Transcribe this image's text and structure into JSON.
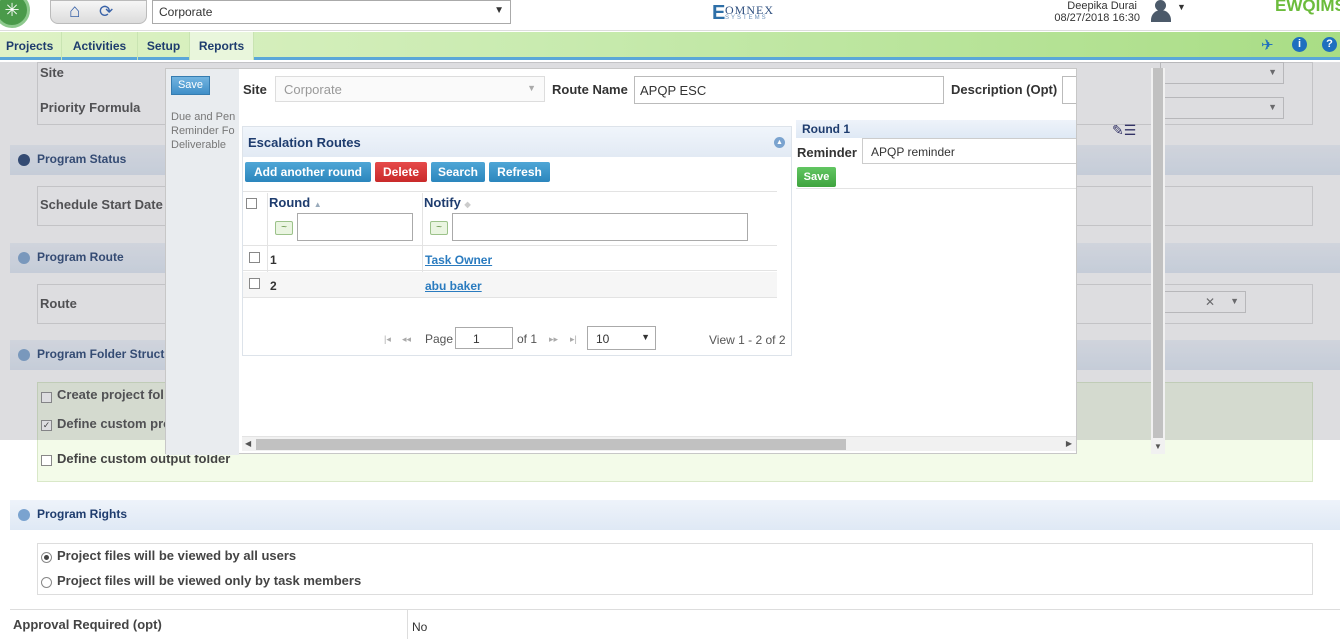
{
  "topbar": {
    "site_select": "Corporate",
    "brand": {
      "mark": "E",
      "name": "OMNEX",
      "tagline": "SYSTEMS"
    },
    "user_name": "Deepika Durai",
    "user_date": "08/27/2018 16:30",
    "app_logo": "EWQIMS"
  },
  "nav": {
    "items": [
      "Projects",
      "Activities",
      "Setup",
      "Reports"
    ]
  },
  "background": {
    "site_label": "Site",
    "priority_formula_label": "Priority Formula",
    "program_status": "Program Status",
    "schedule_start_date": "Schedule Start Date",
    "program_route": "Program Route",
    "route_label": "Route",
    "program_folder": "Program Folder Struct",
    "create_project_folder": "Create project fol",
    "define_custom_pro": "Define custom pro",
    "define_custom_output": "Define custom output folder",
    "program_rights": "Program Rights",
    "rights_all_users": "Project files will be viewed by all users",
    "rights_task_members": "Project files will be viewed only by task members",
    "approval_label": "Approval Required (opt)",
    "approval_value": "No"
  },
  "modal": {
    "save_label": "Save",
    "left_labels": [
      "Due and Pen",
      "Reminder Fo",
      "Deliverable"
    ],
    "site_label": "Site",
    "site_value": "Corporate",
    "route_name_label": "Route Name",
    "route_name_value": "APQP ESC",
    "description_label": "Description (Opt)",
    "grid": {
      "title": "Escalation Routes",
      "buttons": {
        "add": "Add another round",
        "delete": "Delete",
        "search": "Search",
        "refresh": "Refresh"
      },
      "columns": [
        "Round",
        "Notify"
      ],
      "filter_symbol": "~",
      "rows": [
        {
          "round": "1",
          "notify": "Task Owner"
        },
        {
          "round": "2",
          "notify": "abu baker"
        }
      ],
      "pager": {
        "page_label": "Page",
        "page_value": "1",
        "of_label": "of 1",
        "per_page": "10",
        "view": "View 1 - 2 of 2"
      }
    },
    "round": {
      "title": "Round 1",
      "reminder_label": "Reminder",
      "reminder_value": "APQP reminder",
      "save_label": "Save"
    }
  },
  "colors": {
    "nav_accent": "#5aa7d8",
    "link": "#2a7bbf",
    "delete": "#c92a2a",
    "save_green": "#3ea33e"
  }
}
